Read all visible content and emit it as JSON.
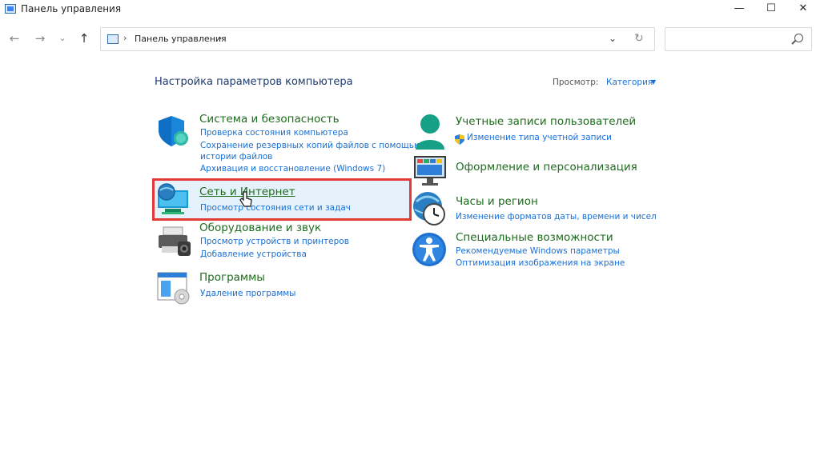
{
  "window": {
    "title": "Панель управления",
    "min_icon": "minimize-icon",
    "max_icon": "maximize-icon",
    "close_icon": "close-icon"
  },
  "address_bar": {
    "breadcrumb": "Панель управления",
    "search_placeholder": ""
  },
  "main": {
    "heading": "Настройка параметров компьютера",
    "view_label": "Просмотр:",
    "view_value": "Категория"
  },
  "categories_left": [
    {
      "title": "Система и безопасность",
      "icon": "shield-icon",
      "links": [
        "Проверка состояния компьютера",
        "Сохранение резервных копий файлов с помощью",
        "истории файлов",
        "Архивация и восстановление (Windows 7)"
      ]
    },
    {
      "title": "Сеть и Интернет",
      "icon": "network-globe-icon",
      "links": [
        "Просмотр состояния сети и задач"
      ]
    },
    {
      "title": "Оборудование и звук",
      "icon": "printer-icon",
      "links": [
        "Просмотр устройств и принтеров",
        "Добавление устройства"
      ]
    },
    {
      "title": "Программы",
      "icon": "programs-icon",
      "links": [
        "Удаление программы"
      ]
    }
  ],
  "categories_right": [
    {
      "title": "Учетные записи пользователей",
      "icon": "user-icon",
      "links": [
        "Изменение типа учетной записи"
      ]
    },
    {
      "title": "Оформление и персонализация",
      "icon": "monitor-icon",
      "links": []
    },
    {
      "title": "Часы и регион",
      "icon": "clock-globe-icon",
      "links": [
        "Изменение форматов даты, времени и чисел"
      ]
    },
    {
      "title": "Специальные возможности",
      "icon": "accessibility-icon",
      "links": [
        "Рекомендуемые Windows параметры",
        "Оптимизация изображения на экране"
      ]
    }
  ],
  "colors": {
    "category_title": "#1e6b1e",
    "link": "#1a6fd6",
    "highlight_border": "#e53935"
  }
}
